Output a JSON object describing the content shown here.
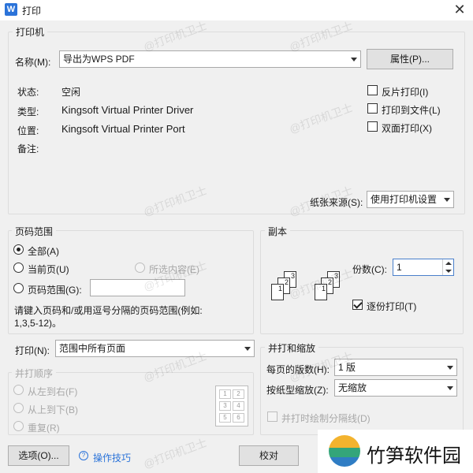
{
  "window": {
    "icon_letter": "W",
    "title": "打印",
    "close": "✕"
  },
  "printer": {
    "group_label": "打印机",
    "name_label": "名称(M):",
    "name_value": "导出为WPS PDF",
    "properties_button": "属性(P)...",
    "status_label": "状态:",
    "status_value": "空闲",
    "type_label": "类型:",
    "type_value": "Kingsoft Virtual Printer Driver",
    "location_label": "位置:",
    "location_value": "Kingsoft Virtual Printer Port",
    "comment_label": "备注:",
    "reverse_print": {
      "label": "反片打印(I)",
      "checked": false
    },
    "print_to_file": {
      "label": "打印到文件(L)",
      "checked": false
    },
    "duplex": {
      "label": "双面打印(X)",
      "checked": false
    },
    "paper_source_label": "纸张来源(S):",
    "paper_source_value": "使用打印机设置"
  },
  "page_range": {
    "group_label": "页码范围",
    "all": {
      "label": "全部(A)",
      "selected": true
    },
    "current": {
      "label": "当前页(U)",
      "selected": false
    },
    "selection": {
      "label": "所选内容(E)",
      "selected": false,
      "disabled": true
    },
    "pages": {
      "label": "页码范围(G):",
      "selected": false,
      "value": ""
    },
    "hint_line1": "请键入页码和/或用逗号分隔的页码范围(例如:",
    "hint_line2": "1,3,5-12)。"
  },
  "copies": {
    "group_label": "副本",
    "count_label": "份数(C):",
    "count_value": "1",
    "collate": {
      "label": "逐份打印(T)",
      "checked": true
    },
    "page_numbers": [
      "1",
      "2",
      "3"
    ]
  },
  "print_what": {
    "label": "打印(N):",
    "value": "范围中所有页面"
  },
  "collation_order": {
    "group_label": "并打顺序",
    "left_to_right": "从左到右(F)",
    "top_to_bottom": "从上到下(B)",
    "repeat": "重复(R)",
    "grid_numbers": [
      "1",
      "2",
      "3",
      "4",
      "5",
      "6"
    ]
  },
  "zoom": {
    "group_label": "并打和缩放",
    "pages_per_sheet_label": "每页的版数(H):",
    "pages_per_sheet_value": "1 版",
    "scale_label": "按纸型缩放(Z):",
    "scale_value": "无缩放",
    "draw_borders": {
      "label": "并打时绘制分隔线(D)",
      "checked": false
    }
  },
  "footer": {
    "options_button": "选项(O)...",
    "tips_icon": "help-icon",
    "tips_link": "操作技巧",
    "proof_button": "校对"
  },
  "watermark": {
    "text": "@打印机卫士"
  },
  "overlay_logo": {
    "text": "竹笋软件园"
  }
}
